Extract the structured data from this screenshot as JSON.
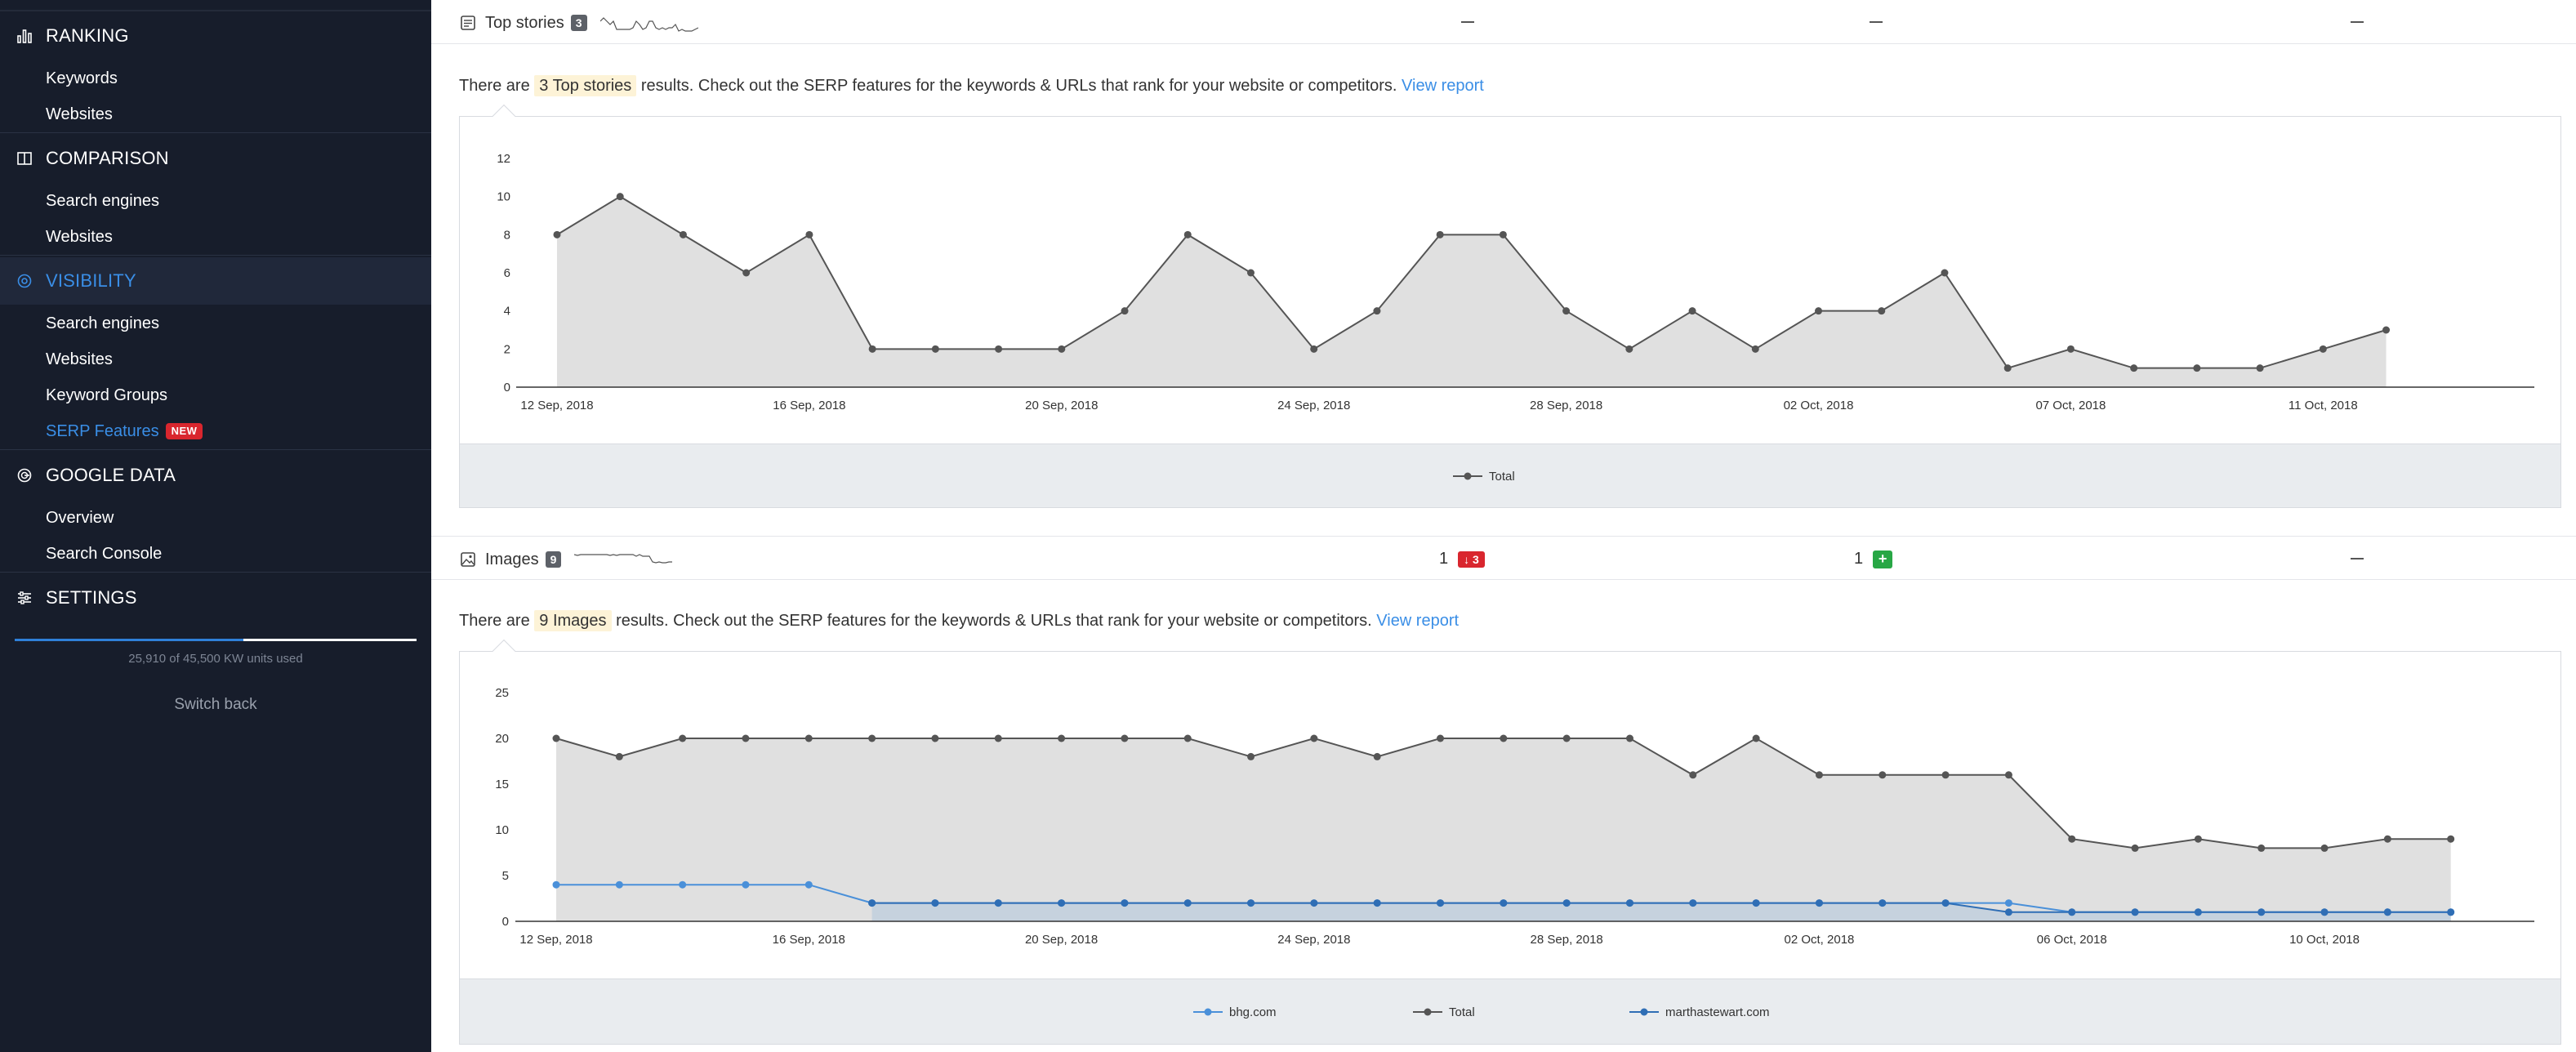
{
  "sidebar": {
    "sections": [
      {
        "id": "ranking",
        "label": "RANKING",
        "icon": "bar-chart-icon",
        "items": [
          "Keywords",
          "Websites"
        ]
      },
      {
        "id": "comparison",
        "label": "COMPARISON",
        "icon": "compare-icon",
        "items": [
          "Search engines",
          "Websites"
        ]
      },
      {
        "id": "visibility",
        "label": "VISIBILITY",
        "icon": "eye-icon",
        "items": [
          "Search engines",
          "Websites",
          "Keyword Groups",
          "SERP Features"
        ],
        "active": true
      },
      {
        "id": "google",
        "label": "GOOGLE DATA",
        "icon": "google-icon",
        "items": [
          "Overview",
          "Search Console"
        ]
      },
      {
        "id": "settings",
        "label": "SETTINGS",
        "icon": "sliders-icon",
        "items": []
      }
    ],
    "active_item": "SERP Features",
    "new_badge": "NEW",
    "usage_text": "25,910 of 45,500 KW units used",
    "usage_fraction": 0.569,
    "switch_back": "Switch back"
  },
  "features": [
    {
      "id": "top-stories",
      "title": "Top stories",
      "icon": "newspaper-icon",
      "count": "3",
      "col1": "",
      "col2": "",
      "col3": "",
      "info": {
        "pre": "There are",
        "highlight": "3 Top stories",
        "post": "results. Check out the SERP features for the keywords & URLs that rank for your website or competitors.",
        "link": "View report"
      }
    },
    {
      "id": "images",
      "title": "Images",
      "icon": "image-icon",
      "count": "9",
      "col1": "1",
      "col1_badge": "↓ 3",
      "col2": "1",
      "col2_badge": "+",
      "col3": "",
      "info": {
        "pre": "There are",
        "highlight": "9 Images",
        "post": "results. Check out the SERP features for the keywords & URLs that rank for your website or competitors.",
        "link": "View report"
      }
    }
  ],
  "chart_data": [
    {
      "type": "area",
      "x": [
        "12 Sep, 2018",
        "13 Sep, 2018",
        "14 Sep, 2018",
        "15 Sep, 2018",
        "16 Sep, 2018",
        "17 Sep, 2018",
        "18 Sep, 2018",
        "19 Sep, 2018",
        "20 Sep, 2018",
        "21 Sep, 2018",
        "22 Sep, 2018",
        "23 Sep, 2018",
        "24 Sep, 2018",
        "25 Sep, 2018",
        "26 Sep, 2018",
        "27 Sep, 2018",
        "28 Sep, 2018",
        "29 Sep, 2018",
        "30 Sep, 2018",
        "01 Oct, 2018",
        "02 Oct, 2018",
        "03 Oct, 2018",
        "04 Oct, 2018",
        "05 Oct, 2018",
        "06 Oct, 2018",
        "07 Oct, 2018",
        "08 Oct, 2018",
        "09 Oct, 2018",
        "10 Oct, 2018",
        "11 Oct, 2018",
        "12 Oct, 2018",
        "13 Oct, 2018"
      ],
      "tick_labels": [
        "12 Sep, 2018",
        "16 Sep, 2018",
        "20 Sep, 2018",
        "24 Sep, 2018",
        "28 Sep, 2018",
        "02 Oct, 2018",
        "07 Oct, 2018",
        "11 Oct, 2018"
      ],
      "tick_indices": [
        0,
        4,
        8,
        12,
        16,
        20,
        24,
        28
      ],
      "yticks": [
        0,
        2,
        4,
        6,
        8,
        10,
        12
      ],
      "ylim": [
        0,
        12
      ],
      "series": [
        {
          "name": "Total",
          "color": "#555555",
          "fill": "#e0e0e0",
          "values": [
            8,
            10,
            8,
            6,
            8,
            2,
            2,
            2,
            2,
            4,
            8,
            6,
            2,
            4,
            8,
            8,
            4,
            2,
            4,
            2,
            4,
            4,
            6,
            1,
            2,
            1,
            1,
            1,
            2,
            3
          ]
        }
      ],
      "legend": "bottom-center"
    },
    {
      "type": "area",
      "x": [
        "12 Sep, 2018",
        "13 Sep, 2018",
        "14 Sep, 2018",
        "15 Sep, 2018",
        "16 Sep, 2018",
        "17 Sep, 2018",
        "18 Sep, 2018",
        "19 Sep, 2018",
        "20 Sep, 2018",
        "21 Sep, 2018",
        "22 Sep, 2018",
        "23 Sep, 2018",
        "24 Sep, 2018",
        "25 Sep, 2018",
        "26 Sep, 2018",
        "27 Sep, 2018",
        "28 Sep, 2018",
        "29 Sep, 2018",
        "30 Sep, 2018",
        "01 Oct, 2018",
        "02 Oct, 2018",
        "03 Oct, 2018",
        "04 Oct, 2018",
        "05 Oct, 2018",
        "06 Oct, 2018",
        "07 Oct, 2018",
        "08 Oct, 2018",
        "09 Oct, 2018",
        "10 Oct, 2018",
        "11 Oct, 2018",
        "12 Oct, 2018",
        "13 Oct, 2018"
      ],
      "tick_labels": [
        "12 Sep, 2018",
        "16 Sep, 2018",
        "20 Sep, 2018",
        "24 Sep, 2018",
        "28 Sep, 2018",
        "02 Oct, 2018",
        "06 Oct, 2018",
        "10 Oct, 2018"
      ],
      "tick_indices": [
        0,
        4,
        8,
        12,
        16,
        20,
        24,
        28
      ],
      "yticks": [
        0,
        5,
        10,
        15,
        20,
        25
      ],
      "ylim": [
        0,
        25
      ],
      "series": [
        {
          "name": "Total",
          "color": "#555555",
          "fill": "#e0e0e0",
          "values": [
            20,
            18,
            20,
            20,
            20,
            20,
            20,
            20,
            20,
            20,
            20,
            18,
            20,
            18,
            20,
            20,
            20,
            20,
            16,
            20,
            16,
            16,
            16,
            16,
            9,
            8,
            9,
            8,
            8,
            9,
            9
          ]
        },
        {
          "name": "bhg.com",
          "color": "#4a90d9",
          "fill": "none",
          "values": [
            4,
            4,
            4,
            4,
            4,
            2,
            2,
            2,
            2,
            2,
            2,
            2,
            null,
            2,
            2,
            2,
            2,
            2,
            2,
            2,
            2,
            2,
            2,
            2,
            1,
            1,
            1,
            1,
            1,
            1,
            1
          ]
        },
        {
          "name": "marthastewart.com",
          "color": "#2f6eb5",
          "fill": "#c6d2de",
          "values": [
            null,
            null,
            null,
            null,
            null,
            2,
            2,
            2,
            2,
            2,
            2,
            2,
            2,
            2,
            2,
            2,
            2,
            2,
            2,
            2,
            2,
            2,
            2,
            1,
            1,
            1,
            1,
            1,
            1,
            1,
            1
          ]
        }
      ],
      "legend_order": [
        "bhg.com",
        "Total",
        "marthastewart.com"
      ],
      "legend": "bottom-center"
    }
  ]
}
